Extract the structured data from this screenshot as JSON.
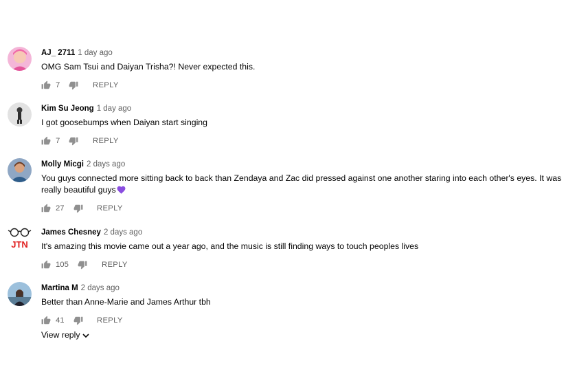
{
  "comments": [
    {
      "author": "AJ_ 2711",
      "time": "1 day ago",
      "text": "OMG Sam Tsui and Daiyan Trisha?! Never expected this.",
      "likes": "7",
      "reply_label": "REPLY"
    },
    {
      "author": "Kim Su Jeong",
      "time": "1 day ago",
      "text": "I got goosebumps when Daiyan start singing",
      "likes": "7",
      "reply_label": "REPLY"
    },
    {
      "author": "Molly Micgi",
      "time": "2 days ago",
      "text": "You guys connected more sitting back to back than Zendaya and Zac did pressed against one another staring into each other's eyes. It was really beautiful guys",
      "emoji": "purple-heart-icon",
      "likes": "27",
      "reply_label": "REPLY"
    },
    {
      "author": "James Chesney",
      "time": "2 days ago",
      "text": "It's amazing this movie came out a year ago, and the music is still finding ways to touch peoples lives",
      "avatar_text": "JTN",
      "likes": "105",
      "reply_label": "REPLY"
    },
    {
      "author": "Martina M",
      "time": "2 days ago",
      "text": "Better than Anne-Marie and James Arthur tbh",
      "likes": "41",
      "reply_label": "REPLY"
    }
  ],
  "view_reply_label": "View reply",
  "colors": {
    "author": "#030303",
    "meta": "#606060",
    "icon": "#909090",
    "jtn_red": "#e02020",
    "heart": "#8a4de0"
  },
  "icons": [
    "thumbs-up-icon",
    "thumbs-down-icon",
    "chevron-down-icon"
  ]
}
